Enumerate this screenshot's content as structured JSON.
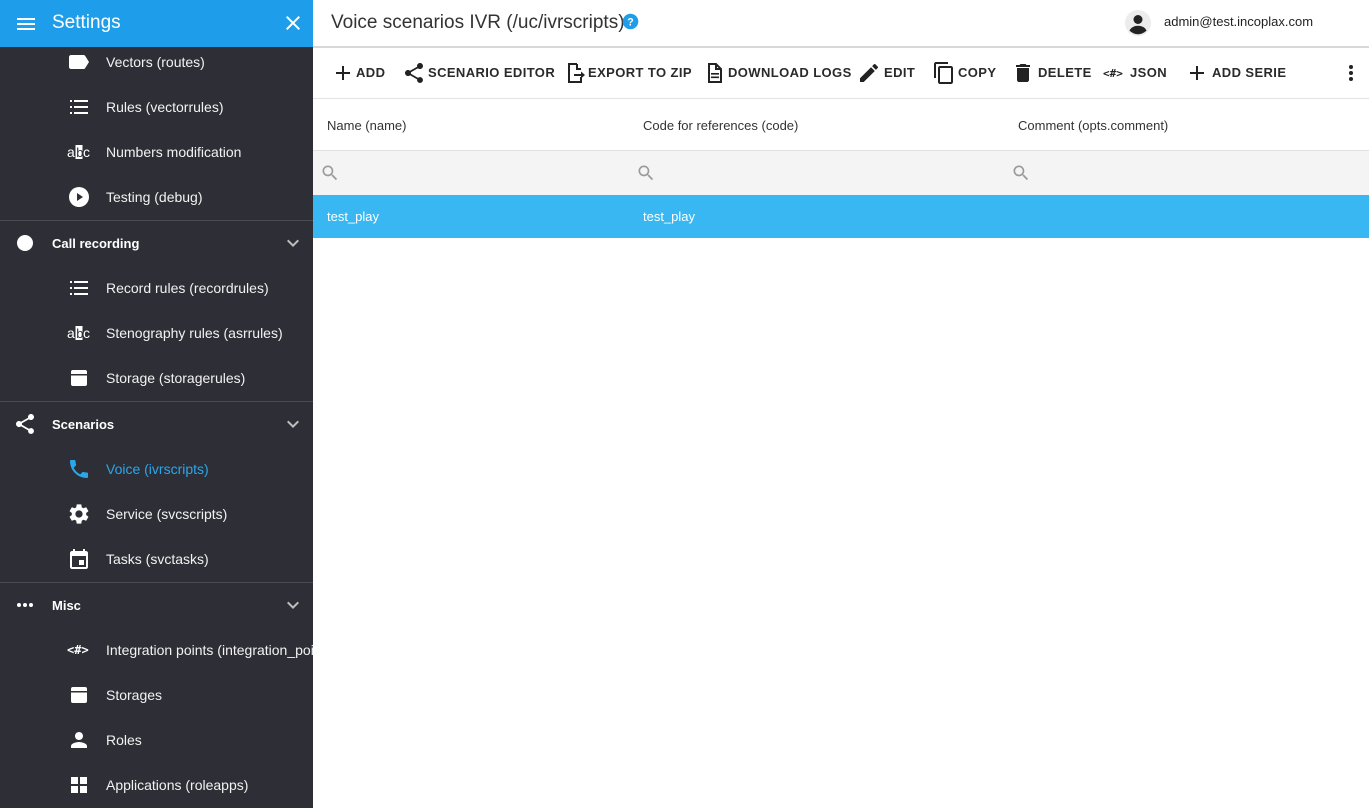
{
  "sidebar": {
    "title": "Settings",
    "items": {
      "vectors": "Vectors (routes)",
      "rules": "Rules (vectorrules)",
      "numbers": "Numbers modification",
      "testing": "Testing (debug)",
      "record_rules": "Record rules (recordrules)",
      "steno_rules": "Stenography rules (asrrules)",
      "storage_rules": "Storage (storagerules)",
      "voice": "Voice (ivrscripts)",
      "service": "Service (svcscripts)",
      "tasks": "Tasks (svctasks)",
      "integration": "Integration points (integration_points",
      "storages": "Storages",
      "roles": "Roles",
      "applications": "Applications (roleapps)"
    },
    "groups": {
      "call_recording": "Call recording",
      "scenarios": "Scenarios",
      "misc": "Misc"
    },
    "active_color": "#2aa7ec",
    "header_color": "#1e9eea",
    "background_color": "#2e2e36"
  },
  "header": {
    "title": "Voice scenarios IVR (/uc/ivrscripts)",
    "user_email": "admin@test.incoplax.com"
  },
  "toolbar": {
    "add": "ADD",
    "scenario_editor": "SCENARIO EDITOR",
    "export_zip": "EXPORT TO ZIP",
    "download_logs": "DOWNLOAD LOGS",
    "edit": "EDIT",
    "copy": "COPY",
    "delete": "DELETE",
    "json": "JSON",
    "add_serie": "ADD SERIE"
  },
  "table": {
    "columns": {
      "name": "Name (name)",
      "code": "Code for references (code)",
      "comment": "Comment (opts.comment)"
    },
    "filters": {
      "name": "",
      "code": "",
      "comment": ""
    },
    "rows": [
      {
        "name": "test_play",
        "code": "test_play",
        "comment": ""
      }
    ],
    "selected_row_color": "#38b7f2"
  }
}
